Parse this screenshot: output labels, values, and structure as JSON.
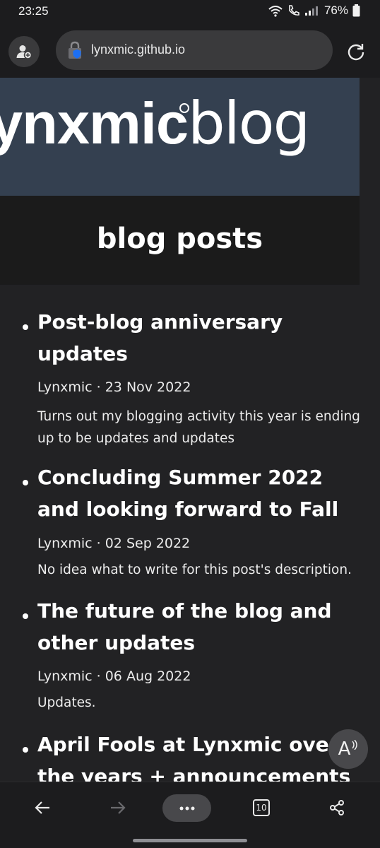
{
  "status_bar": {
    "time": "23:25",
    "battery": "76%",
    "icons": [
      "wifi-icon",
      "call-icon",
      "signal-icon",
      "battery-icon"
    ]
  },
  "browser": {
    "url": "lynxmic.github.io",
    "icons": [
      "profile-icon",
      "lock-icon",
      "reload-icon"
    ]
  },
  "banner": {
    "logo_bold": "ynxmic",
    "logo_thin": "blog"
  },
  "page": {
    "title": "blog posts"
  },
  "posts": [
    {
      "title_lines": [
        "Post-blog anniversary",
        "updates"
      ],
      "meta": "Lynxmic · 23 Nov 2022",
      "description": "Turns out my blogging activity this year is ending up to be updates and updates"
    },
    {
      "title_lines": [
        "Concluding Summer 2022",
        "and looking forward to Fall"
      ],
      "meta": "Lynxmic · 02 Sep 2022",
      "description": "No idea what to write for this post's description."
    },
    {
      "title_lines": [
        "The future of the blog and",
        "other updates"
      ],
      "meta": "Lynxmic · 06 Aug 2022",
      "description": "Updates."
    },
    {
      "title_lines": [
        "April Fools at Lynxmic over",
        "the years + announcements"
      ],
      "meta": "",
      "description": ""
    }
  ],
  "read_aloud": {
    "label": "A"
  },
  "bottom_nav": {
    "tab_count": "10",
    "icons": [
      "back-arrow-icon",
      "forward-arrow-icon",
      "more-icon",
      "tabs-icon",
      "share-icon"
    ]
  },
  "colors": {
    "banner_bg": "#344050",
    "page_bg": "#222224",
    "title_band_bg": "#1b1b1b",
    "chrome_bg": "#1c1c1e",
    "pill_bg": "#3a3a3c",
    "lock_blue": "#1d6ff2"
  }
}
